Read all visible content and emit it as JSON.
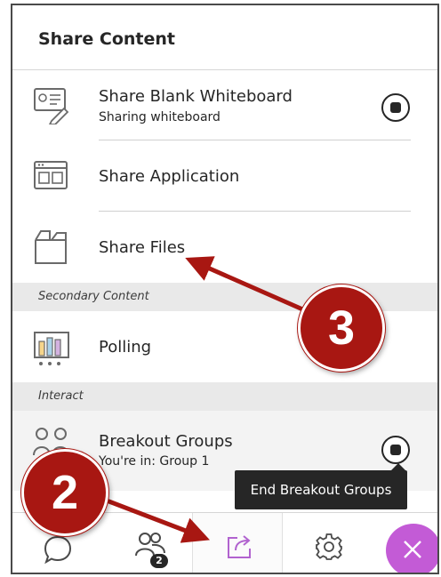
{
  "header": {
    "title": "Share Content"
  },
  "share_items": [
    {
      "label": "Share Blank Whiteboard",
      "sub": "Sharing whiteboard"
    },
    {
      "label": "Share Application"
    },
    {
      "label": "Share Files"
    }
  ],
  "sections": {
    "secondary": "Secondary Content",
    "interact": "Interact"
  },
  "polling": {
    "label": "Polling"
  },
  "breakout": {
    "label": "Breakout Groups",
    "sub": "You're in: Group 1"
  },
  "tooltip": {
    "text": "End Breakout Groups"
  },
  "bottom_bar": {
    "attendees_badge": "2"
  },
  "callouts": {
    "first": "2",
    "second": "3"
  },
  "colors": {
    "accent_purple": "#c35bd6",
    "callout_red": "#a81712",
    "active_icon": "#b163cf",
    "section_bg": "#e9e9e9"
  },
  "icons": [
    "whiteboard-icon",
    "application-icon",
    "files-icon",
    "polling-icon",
    "breakout-groups-icon",
    "chat-icon",
    "attendees-icon",
    "share-content-icon",
    "settings-icon",
    "close-icon"
  ]
}
